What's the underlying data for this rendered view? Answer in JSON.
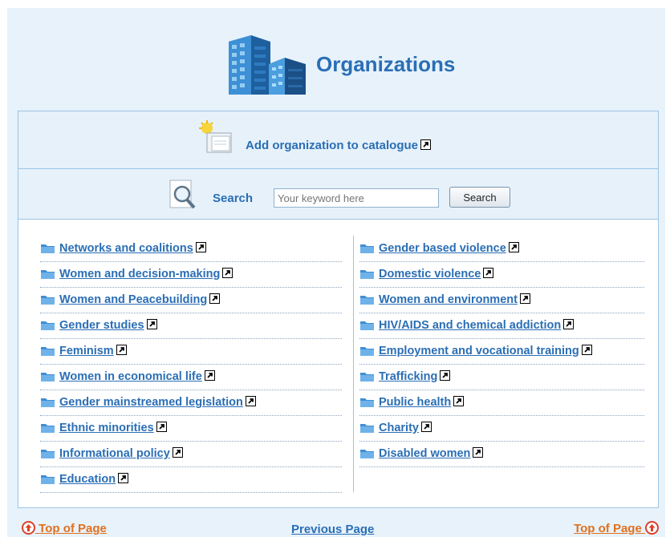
{
  "header": {
    "title": "Organizations",
    "logo_icon": "buildings-icon"
  },
  "add_organization": {
    "label": "Add organization to catalogue",
    "icon": "new-document-icon"
  },
  "search": {
    "label": "Search",
    "placeholder": "Your keyword here",
    "button_label": "Search",
    "icon": "magnifier-icon"
  },
  "categories_left": [
    {
      "label": "Networks and coalitions"
    },
    {
      "label": "Women and decision-making"
    },
    {
      "label": "Women and Peacebuilding"
    },
    {
      "label": "Gender studies"
    },
    {
      "label": "Feminism"
    },
    {
      "label": "Women in economical life"
    },
    {
      "label": "Gender mainstreamed legislation"
    },
    {
      "label": "Ethnic minorities"
    },
    {
      "label": "Informational policy"
    },
    {
      "label": "Education"
    }
  ],
  "categories_right": [
    {
      "label": "Gender based violence"
    },
    {
      "label": "Domestic violence"
    },
    {
      "label": "Women and environment"
    },
    {
      "label": "HIV/AIDS and chemical addiction"
    },
    {
      "label": "Employment and vocational training"
    },
    {
      "label": "Trafficking"
    },
    {
      "label": "Public health"
    },
    {
      "label": "Charity"
    },
    {
      "label": "Disabled women"
    }
  ],
  "footer": {
    "top_left": "Top of Page",
    "previous": "Previous Page",
    "top_right": "Top of Page"
  },
  "colors": {
    "link": "#2a6eb5",
    "accent_orange": "#e0701f",
    "panel_bg": "#e6f1fa"
  }
}
